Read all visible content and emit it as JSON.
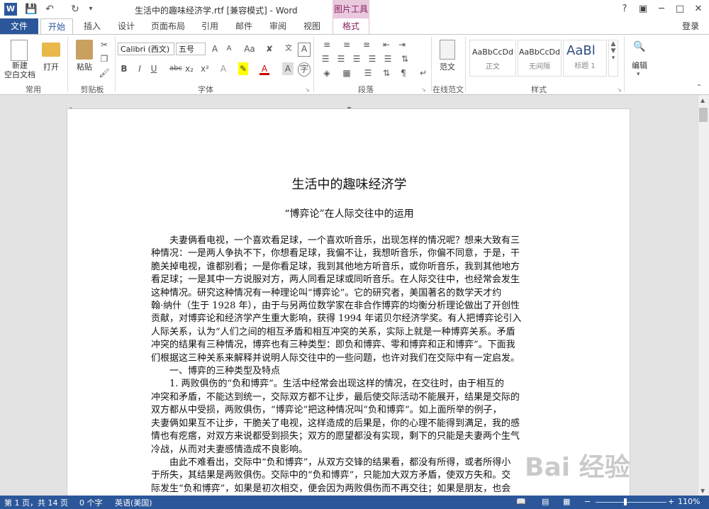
{
  "titlebar": {
    "app_badge": "W",
    "title": "生活中的趣味经济学.rtf [兼容模式] - Word",
    "contextual_tab_group": "图片工具",
    "help": "?",
    "minimize": "─",
    "restore": "□",
    "close": "✕"
  },
  "tabs": [
    "文件",
    "开始",
    "插入",
    "设计",
    "页面布局",
    "引用",
    "邮件",
    "审阅",
    "视图",
    "格式"
  ],
  "signin": "登录",
  "ribbon": {
    "groups": {
      "common": "常用",
      "clipboard": "剪贴板",
      "font": "字体",
      "paragraph": "段落",
      "online_template": "在线范文",
      "styles": "样式"
    },
    "new_doc": "新建\n空白文档",
    "new_doc_line1": "新建",
    "new_doc_line2": "空白文档",
    "open": "打开",
    "paste": "粘贴",
    "font_name": "Calibri (西文)",
    "font_size": "五号",
    "template": "范文",
    "edit": "编辑",
    "styles": [
      {
        "preview": "AaBbCcDd",
        "name": "正文"
      },
      {
        "preview": "AaBbCcDd",
        "name": "无间隔"
      },
      {
        "preview": "AaBl",
        "name": "标题 1"
      }
    ],
    "font_buttons": [
      "B",
      "I",
      "U",
      "abc",
      "x₂",
      "x²"
    ]
  },
  "document": {
    "title": "生活中的趣味经济学",
    "subtitle": "“博弈论”在人际交往中的运用",
    "p1": [
      "夫妻俩看电视，一个喜欢看足球，一个喜欢听音乐，出现怎样的情况呢？想来大致有三",
      "种情况：一是两人争执不下，你想看足球，我偏不让，我想听音乐，你偏不同意，于是，干",
      "脆关掉电视，谁都别看；一是你看足球，我到其他地方听音乐，或你听音乐，我到其他地方",
      "看足球；一是其中一方说服对方，两人同看足球或同听音乐。在人际交往中，也经常会发生",
      "这种情况。研究这种情况有一种理论叫“博弈论”。它的研究者，美国著名的数学天才约",
      "翰·纳什（生于 1928 年），由于与另两位数学家在非合作博弈的均衡分析理论做出了开创性",
      "贡献，对博弈论和经济学产生重大影响，获得 1994 年诺贝尔经济学奖。有人把博弈论引入",
      "人际关系，认为“人们之间的相互矛盾和相互冲突的关系，实际上就是一种博弈关系。矛盾",
      "冲突的结果有三种情况，博弈也有三种类型：即负和博弈、零和博弈和正和博弈”。下面我",
      "们根据这三种关系来解释并说明人际交往中的一些问题，也许对我们在交际中有一定启发。"
    ],
    "section1": "一、博弈的三种类型及特点",
    "p2": [
      "1. 两败俱伤的“负和博弈”。生活中经常会出现这样的情况，在交往时，由于相互的",
      "冲突和矛盾，不能达到统一，交际双方都不让步，最后使交际活动不能展开，结果是交际的",
      "双方都从中受损，两败俱伤，“博弈论”把这种情况叫“负和博弈”。如上面所举的例子，",
      "夫妻俩如果互不让步，干脆关了电视，这样造成的后果是，你的心理不能得到满足，我的感",
      "情也有疙瘩，对双方来说都受到损失；双方的愿望都没有实现，剩下的只能是夫妻两个生气",
      "冷战，从而对夫妻感情造成不良影响。"
    ],
    "p3": [
      "由此不难看出，交际中“负和博弈”，从双方交锋的结果看，都没有所得，或者所得小",
      "于所失，其结果是两败俱伤。交际中的“负和博弈”，只能加大双方矛盾，使双方失和。交",
      "际发生“负和博弈”，如果是初次相交，便会因为两败俱伤而不再交往；如果是朋友，也会"
    ]
  },
  "status": {
    "page": "第 1 页，共 14 页",
    "words": "0 个字",
    "language": "英语(美国)",
    "zoom": "110%"
  },
  "watermark": "Bai 经验"
}
